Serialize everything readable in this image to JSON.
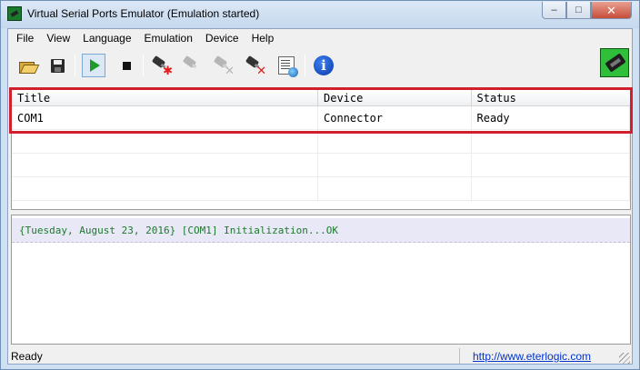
{
  "window": {
    "title": "Virtual Serial Ports Emulator (Emulation started)",
    "caption_minimize": "–",
    "caption_maximize": "□",
    "caption_close": "✕"
  },
  "menu": {
    "items": [
      {
        "label": "File"
      },
      {
        "label": "View"
      },
      {
        "label": "Language"
      },
      {
        "label": "Emulation"
      },
      {
        "label": "Device"
      },
      {
        "label": "Help"
      }
    ]
  },
  "toolbar": {
    "info_glyph": "i",
    "new_device_mark": "✱",
    "delete_mark": "✕",
    "icons": [
      "open-icon",
      "save-icon",
      "play-icon",
      "stop-icon",
      "new-device-icon",
      "device-settings-icon",
      "disconnect-device-icon",
      "delete-device-icon",
      "properties-icon",
      "info-icon",
      "brand-icon"
    ]
  },
  "ports_table": {
    "columns": [
      "Title",
      "Device",
      "Status"
    ],
    "rows": [
      [
        "COM1",
        "Connector",
        "Ready"
      ]
    ]
  },
  "log": {
    "lines": [
      "{Tuesday, August 23, 2016} [COM1] Initialization...OK"
    ]
  },
  "status_bar": {
    "text": "Ready",
    "link": "http://www.eterlogic.com"
  },
  "colors": {
    "highlight": "#d0202c",
    "log_text": "#1b7a2b",
    "link": "#0033cc"
  }
}
